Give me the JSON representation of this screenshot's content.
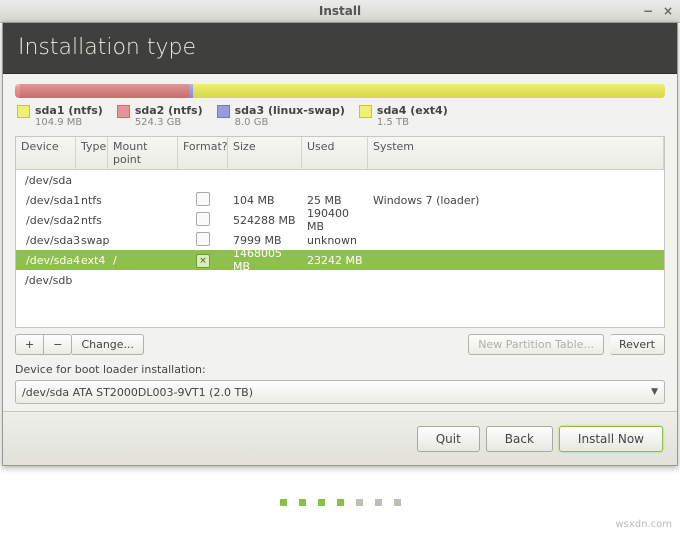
{
  "window_title": "Install",
  "heading": "Installation type",
  "segments": [
    {
      "class": "p1",
      "width": "0.8%"
    },
    {
      "class": "p2",
      "width": "26%"
    },
    {
      "class": "p3",
      "width": "0.6%"
    },
    {
      "class": "p4",
      "width": "72.6%"
    }
  ],
  "legend": [
    {
      "swatch": "#f0f076",
      "stroke": "#c8c820",
      "name": "sda1 (ntfs)",
      "sub": "104.9 MB"
    },
    {
      "swatch": "#e59595",
      "stroke": "#c86f6f",
      "name": "sda2 (ntfs)",
      "sub": "524.3 GB"
    },
    {
      "swatch": "#9a9ae0",
      "stroke": "#7a7ac0",
      "name": "sda3 (linux-swap)",
      "sub": "8.0 GB"
    },
    {
      "swatch": "#f0f076",
      "stroke": "#c8c820",
      "name": "sda4 (ext4)",
      "sub": "1.5 TB"
    }
  ],
  "columns": {
    "device": "Device",
    "type": "Type",
    "mount": "Mount point",
    "format": "Format?",
    "size": "Size",
    "used": "Used",
    "system": "System"
  },
  "rows": [
    {
      "kind": "parent",
      "device": "/dev/sda"
    },
    {
      "kind": "child",
      "device": "/dev/sda1",
      "type": "ntfs",
      "mount": "",
      "format": false,
      "size": "104 MB",
      "used": "25 MB",
      "system": "Windows 7 (loader)"
    },
    {
      "kind": "child",
      "device": "/dev/sda2",
      "type": "ntfs",
      "mount": "",
      "format": false,
      "size": "524288 MB",
      "used": "190400 MB",
      "system": ""
    },
    {
      "kind": "child",
      "device": "/dev/sda3",
      "type": "swap",
      "mount": "",
      "format": false,
      "size": "7999 MB",
      "used": "unknown",
      "system": ""
    },
    {
      "kind": "child",
      "device": "/dev/sda4",
      "type": "ext4",
      "mount": "/",
      "format": true,
      "size": "1468005 MB",
      "used": "23242 MB",
      "system": "",
      "selected": true
    },
    {
      "kind": "parent",
      "device": "/dev/sdb"
    }
  ],
  "toolbar": {
    "add": "+",
    "remove": "−",
    "change": "Change...",
    "new_table": "New Partition Table...",
    "revert": "Revert"
  },
  "boot_label": "Device for boot loader installation:",
  "boot_value": "/dev/sda   ATA ST2000DL003-9VT1 (2.0 TB)",
  "footer": {
    "quit": "Quit",
    "back": "Back",
    "install": "Install Now"
  },
  "watermark": "wsxdn.com"
}
